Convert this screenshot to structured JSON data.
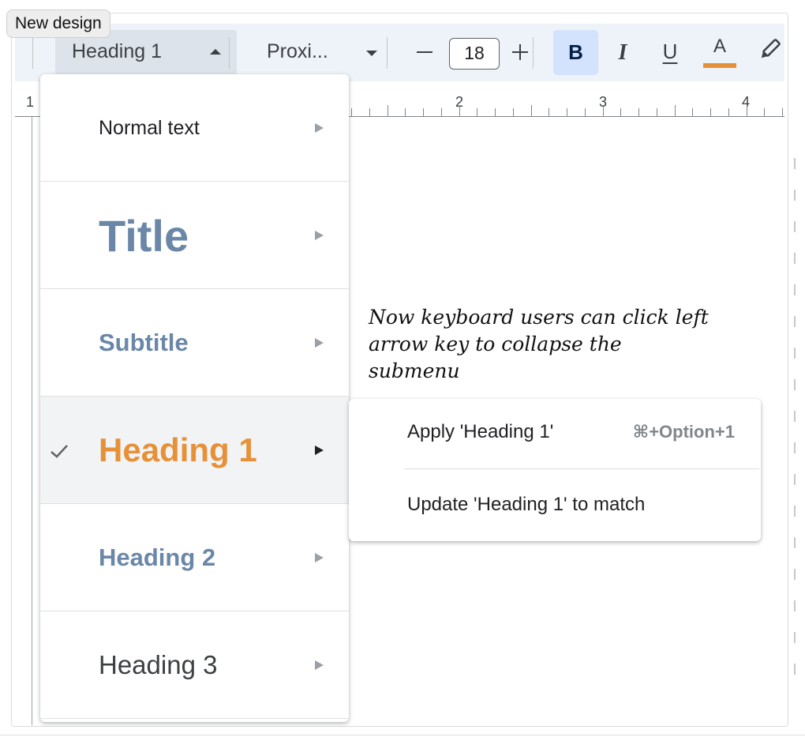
{
  "badge": {
    "label": "New design"
  },
  "toolbar": {
    "style_dropdown": "Heading 1",
    "font_dropdown": "Proxi...",
    "font_size": "18",
    "bold_label": "B",
    "italic_label": "I",
    "underline_label": "U",
    "text_color_label": "A",
    "text_color_hex": "#e69138"
  },
  "ruler": {
    "numbers": [
      "1",
      "2",
      "3",
      "4"
    ]
  },
  "style_menu": {
    "items": [
      {
        "label": "Normal text",
        "selected": false
      },
      {
        "label": "Title",
        "selected": false
      },
      {
        "label": "Subtitle",
        "selected": false
      },
      {
        "label": "Heading 1",
        "selected": true
      },
      {
        "label": "Heading 2",
        "selected": false
      },
      {
        "label": "Heading 3",
        "selected": false
      }
    ]
  },
  "submenu": {
    "apply_label": "Apply 'Heading 1'",
    "apply_shortcut": "⌘+Option+1",
    "update_label": "Update 'Heading 1' to match"
  },
  "annotation": {
    "text": "Now keyboard users can click left arrow key to collapse the submenu"
  },
  "colors": {
    "accent_heading": "#e69138",
    "style_blue": "#6b87a8",
    "toolbar_bg": "#eef2f9",
    "bold_active_bg": "#d3e3fd"
  }
}
